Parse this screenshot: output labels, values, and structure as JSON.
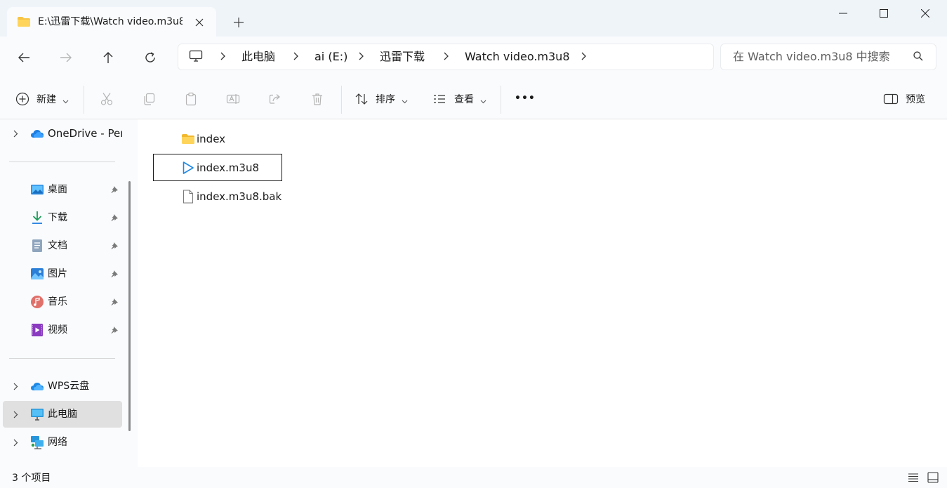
{
  "window": {
    "tab_title": "E:\\迅雷下载\\Watch video.m3u8",
    "new_tab_symbol": "+",
    "close_tab_symbol": "✕"
  },
  "address": {
    "crumbs": [
      "此电脑",
      "ai (E:)",
      "迅雷下载",
      "Watch video.m3u8"
    ]
  },
  "search": {
    "placeholder": "在 Watch video.m3u8 中搜索"
  },
  "toolbar": {
    "new_label": "新建",
    "sort_label": "排序",
    "view_label": "查看",
    "more_label": "•••",
    "preview_label": "预览"
  },
  "sidebar": {
    "onedrive": "OneDrive - Per",
    "quick": [
      {
        "label": "桌面",
        "icon": "desktop-icon"
      },
      {
        "label": "下载",
        "icon": "download-icon"
      },
      {
        "label": "文档",
        "icon": "document-icon"
      },
      {
        "label": "图片",
        "icon": "pictures-icon"
      },
      {
        "label": "音乐",
        "icon": "music-icon"
      },
      {
        "label": "视频",
        "icon": "videos-icon"
      }
    ],
    "wps": "WPS云盘",
    "thispc": "此电脑",
    "network": "网络"
  },
  "files": [
    {
      "name": "index",
      "icon": "folder-icon"
    },
    {
      "name": "index.m3u8",
      "icon": "media-play-icon",
      "selected": true
    },
    {
      "name": "index.m3u8.bak",
      "icon": "file-icon"
    }
  ],
  "status": {
    "item_count": "3 个项目"
  },
  "colors": {
    "chrome_bg": "#eff4f9",
    "pane_bg": "#f9fbfd",
    "accent": "#0067c0",
    "selected_nav_bg": "#e0e0e0"
  }
}
